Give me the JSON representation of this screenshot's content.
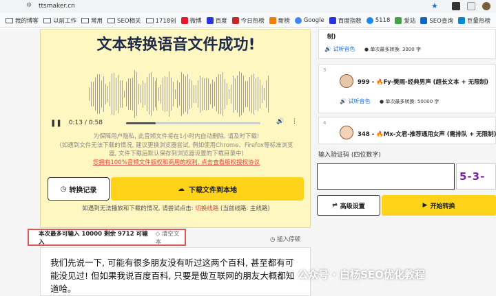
{
  "browser": {
    "url": "ttsmaker.cn",
    "bookmarks": [
      "我的博客",
      "以前工作",
      "常用",
      "SEO相关",
      "1718创",
      "微博",
      "百度",
      "今日热榜",
      "新榜",
      "Google",
      "百度指数",
      "5118",
      "爱站",
      "SEO查询",
      "巨量热榜"
    ]
  },
  "main": {
    "success_title": "文本转换语音文件成功!",
    "audio": {
      "current": "0:13",
      "separator": "/",
      "duration": "0:58",
      "progress": 0.22
    },
    "notice_lines": [
      "为保障用户隐私, 此音频文件将在1小时内自动删除, 请及时下载!",
      "(如遇到文件无法下载的情况, 建议更换浏览器尝试, 例如使用Chrome、Firefox等标准浏览",
      "器, 文件下载后默认保存到浏览器设置的下载目录中)"
    ],
    "copyright_link": "您拥有100%音频文件版权和商用的权利, 点击查看版权授权协议",
    "history_button": "转换记录",
    "download_button": "下载文件到本地",
    "hint_prefix": "如遇到无法播放和下载的情况, 请尝试点击:",
    "hint_link": "切换线路",
    "hint_suffix": "(当前线路: 主线路)",
    "limit_text": "本次最多可输入 10000 剩余 9712 可输入",
    "clear_text": "清空文本",
    "insert_pause": "插入停顿",
    "textarea_text": "我们先说一下, 可能有很多朋友没有听过这两个百科, 甚至都有可能没见过! 但如果我说百度百科, 只要是做互联网的朋友大概都知道哈。"
  },
  "right": {
    "card_top": {
      "tail": "制)",
      "trial": "试听音色",
      "chars": "单次最多转换: 3000 字"
    },
    "card3": {
      "num": "3",
      "voice": "999 - 🔥Fy-樊雨-经典男声 (超长文本 + 无限制)",
      "trial": "试听音色",
      "chars": "单次最多转换: 50000 字"
    },
    "card4": {
      "num": "4",
      "voice": "348 - 🔥Mx-文君-推荐通用女声 (需排队 + 无限制)"
    },
    "captcha_label": "输入验证码 (四位数字)",
    "captcha_value": "",
    "captcha_placeholder": "",
    "captcha_image_text": "5-3-",
    "advanced_button": "高级设置",
    "start_button": "开始转换"
  },
  "watermark": "公众号 · 白杨SEO优化教程",
  "colors": {
    "accent_yellow": "#ffd31a",
    "panel_bg": "#fff7c2",
    "title": "#1e2a4a",
    "link_blue": "#1a73e8",
    "red": "#e0443e",
    "highlight_border": "#e25555"
  }
}
